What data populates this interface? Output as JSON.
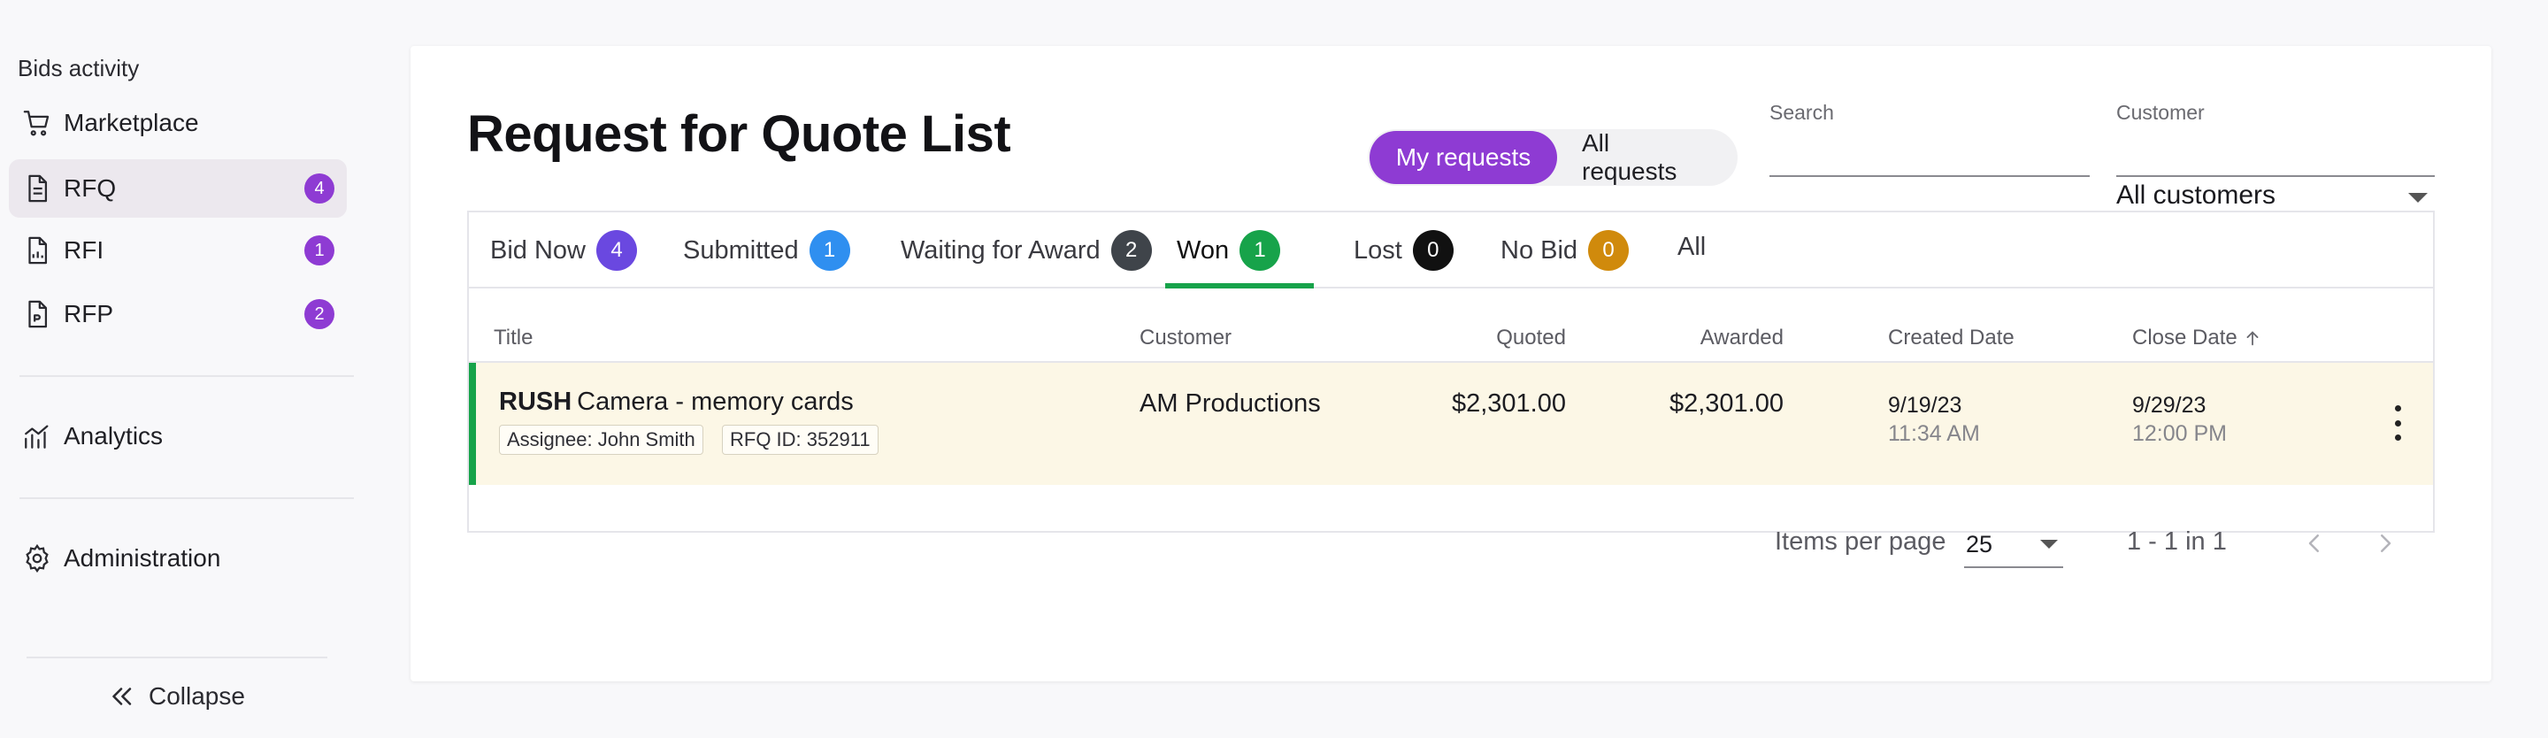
{
  "sidebar": {
    "section_title": "Bids activity",
    "items": [
      {
        "label": "Marketplace",
        "icon": "cart-icon"
      },
      {
        "label": "RFQ",
        "icon": "document-icon",
        "badge": "4",
        "active": true
      },
      {
        "label": "RFI",
        "icon": "document-chart-icon",
        "badge": "1"
      },
      {
        "label": "RFP",
        "icon": "document-file-icon",
        "badge": "2"
      }
    ],
    "analytics_label": "Analytics",
    "administration_label": "Administration",
    "collapse_label": "Collapse"
  },
  "main": {
    "title": "Request for Quote List",
    "toggle": {
      "mine": "My requests",
      "all": "All requests",
      "selected": "My requests"
    },
    "search": {
      "label": "Search",
      "value": ""
    },
    "customer": {
      "label": "Customer",
      "value": "All customers"
    },
    "tabs": [
      {
        "label": "Bid Now",
        "count": "4",
        "color": "#6a48e0"
      },
      {
        "label": "Submitted",
        "count": "1",
        "color": "#2f8ff0"
      },
      {
        "label": "Waiting for Award",
        "count": "2",
        "color": "#3f444a"
      },
      {
        "label": "Won",
        "count": "1",
        "color": "#17a34a",
        "active": true
      },
      {
        "label": "Lost",
        "count": "0",
        "color": "#111111"
      },
      {
        "label": "No Bid",
        "count": "0",
        "color": "#d08a0c"
      },
      {
        "label": "All"
      }
    ],
    "columns": {
      "title": "Title",
      "customer": "Customer",
      "quoted": "Quoted",
      "awarded": "Awarded",
      "created": "Created Date",
      "close": "Close Date"
    },
    "rows": [
      {
        "prefix": "RUSH",
        "title": "Camera - memory cards",
        "assignee": "Assignee: John Smith",
        "rfq_id": "RFQ ID: 352911",
        "customer": "AM Productions",
        "quoted": "$2,301.00",
        "awarded": "$2,301.00",
        "created_date": "9/19/23",
        "created_time": "11:34 AM",
        "close_date": "9/29/23",
        "close_time": "12:00 PM"
      }
    ],
    "pagination": {
      "items_per_page_label": "Items per page",
      "items_per_page": "25",
      "range": "1 - 1 in 1"
    }
  },
  "colors": {
    "accent": "#8e3bd3",
    "won": "#17a34a",
    "row_highlight": "#fcf7e6"
  }
}
